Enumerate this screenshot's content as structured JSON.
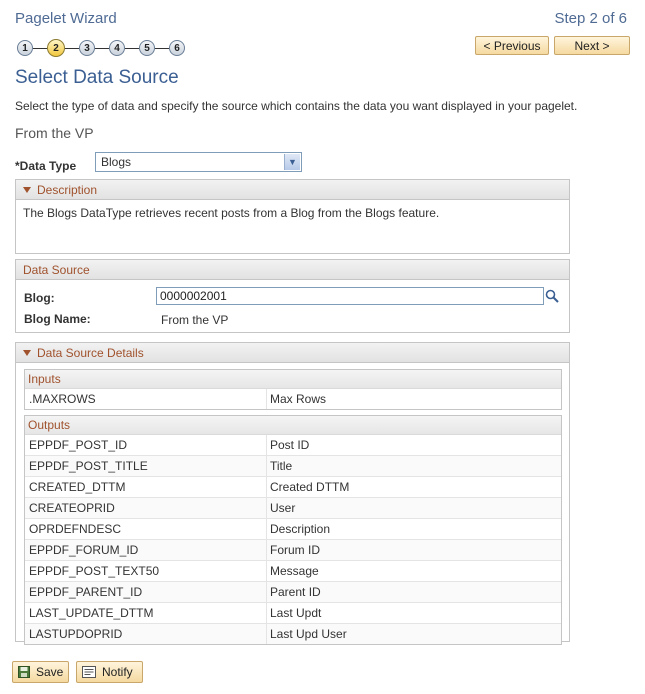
{
  "header": {
    "title": "Pagelet Wizard",
    "step_label": "Step 2 of 6"
  },
  "steps": [
    "1",
    "2",
    "3",
    "4",
    "5",
    "6"
  ],
  "nav": {
    "previous": "< Previous",
    "next": "Next >"
  },
  "page": {
    "title": "Select Data Source",
    "instructions": "Select the type of data and specify the source which contains the data you want displayed in your pagelet.",
    "source_name": "From the VP"
  },
  "data_type": {
    "label": "*Data Type",
    "value": "Blogs"
  },
  "description": {
    "header": "Description",
    "text": "The Blogs DataType retrieves recent posts from a  Blog from the Blogs feature."
  },
  "data_source": {
    "header": "Data Source",
    "blog_label": "Blog:",
    "blog_value": "0000002001",
    "blog_name_label": "Blog Name:",
    "blog_name_value": "From the VP"
  },
  "details": {
    "header": "Data Source Details",
    "inputs_header": "Inputs",
    "inputs": [
      {
        "field": ".MAXROWS",
        "label": "Max Rows"
      }
    ],
    "outputs_header": "Outputs",
    "outputs": [
      {
        "field": "EPPDF_POST_ID",
        "label": "Post ID"
      },
      {
        "field": "EPPDF_POST_TITLE",
        "label": "Title"
      },
      {
        "field": "CREATED_DTTM",
        "label": "Created DTTM"
      },
      {
        "field": "CREATEOPRID",
        "label": "User"
      },
      {
        "field": "OPRDEFNDESC",
        "label": "Description"
      },
      {
        "field": "EPPDF_FORUM_ID",
        "label": "Forum ID"
      },
      {
        "field": "EPPDF_POST_TEXT50",
        "label": "Message"
      },
      {
        "field": "EPPDF_PARENT_ID",
        "label": "Parent ID"
      },
      {
        "field": "LAST_UPDATE_DTTM",
        "label": "Last Updt"
      },
      {
        "field": "LASTUPDOPRID",
        "label": "Last Upd User"
      }
    ]
  },
  "footer": {
    "save": "Save",
    "notify": "Notify"
  },
  "icons": {
    "lookup": "magnifier-icon",
    "save": "save-icon",
    "notify": "notify-icon",
    "collapse": "triangle-down-icon",
    "dropdown": "chevron-down-icon"
  }
}
